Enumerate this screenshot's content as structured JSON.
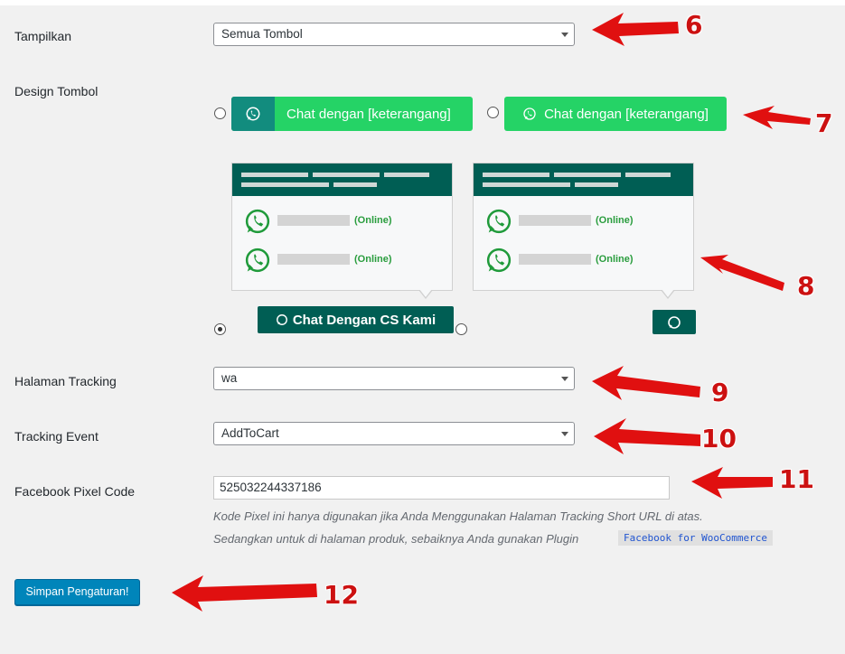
{
  "fields": {
    "tampilkan": {
      "label": "Tampilkan",
      "value": "Semua Tombol"
    },
    "design": {
      "label": "Design Tombol"
    },
    "halaman": {
      "label": "Halaman Tracking",
      "value": "wa"
    },
    "event": {
      "label": "Tracking Event",
      "value": "AddToCart"
    },
    "pixel": {
      "label": "Facebook Pixel Code",
      "value": "525032244337186"
    }
  },
  "design_options": {
    "button1_text": "Chat dengan [keterangang]",
    "button2_text": "Chat dengan [keterangang]",
    "online_label": "(Online)",
    "floating_text": "Chat Dengan CS Kami",
    "selected_index": 3
  },
  "description": {
    "line1": "Kode Pixel ini hanya digunakan jika Anda Menggunakan Halaman Tracking Short URL di atas.",
    "line2": "Sedangkan untuk di halaman produk, sebaiknya Anda gunakan Plugin",
    "plugin": "Facebook for WooCommerce"
  },
  "save_label": "Simpan Pengaturan!",
  "annotations": [
    "6",
    "7",
    "8",
    "9",
    "10",
    "11",
    "12"
  ],
  "colors": {
    "wa_dark": "#128c7e",
    "wa_green": "#25d366",
    "panel_head": "#005e54",
    "primary": "#0085ba",
    "arrow": "#e01010"
  }
}
